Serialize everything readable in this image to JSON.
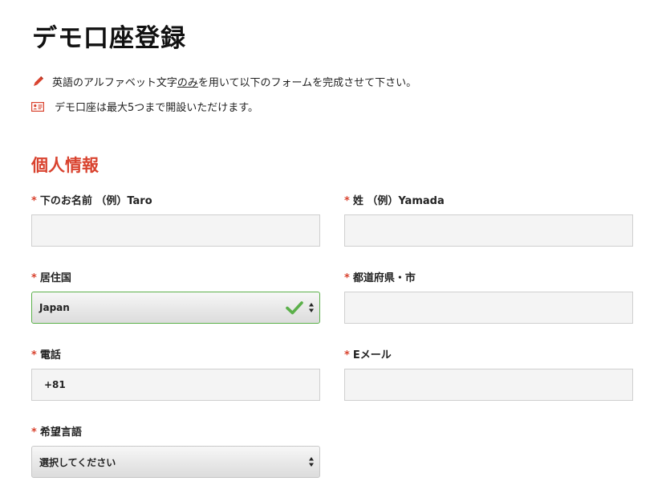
{
  "page": {
    "title": "デモ口座登録"
  },
  "notes": {
    "line1_pre": "英語のアルファベット文字",
    "line1_underlined": "のみ",
    "line1_post": "を用いて以下のフォームを完成させて下さい。",
    "line1_icon": "pencil-icon",
    "line2": "デモ口座は最大5つまで開設いただけます。",
    "line2_icon": "id-card-icon"
  },
  "section": {
    "title": "個人情報"
  },
  "required_mark": "*",
  "fields": {
    "first_name": {
      "label": "下のお名前 （例）Taro",
      "value": ""
    },
    "last_name": {
      "label": "姓 （例）Yamada",
      "value": ""
    },
    "country": {
      "label": "居住国",
      "value": "Japan"
    },
    "city": {
      "label": "都道府県・市",
      "value": ""
    },
    "phone": {
      "label": "電話",
      "value": "+81"
    },
    "email": {
      "label": "Eメール",
      "value": ""
    },
    "language": {
      "label": "希望言語",
      "value": "選択してください"
    }
  },
  "colors": {
    "accent_red": "#d9432f",
    "valid_green": "#5bb04a"
  }
}
